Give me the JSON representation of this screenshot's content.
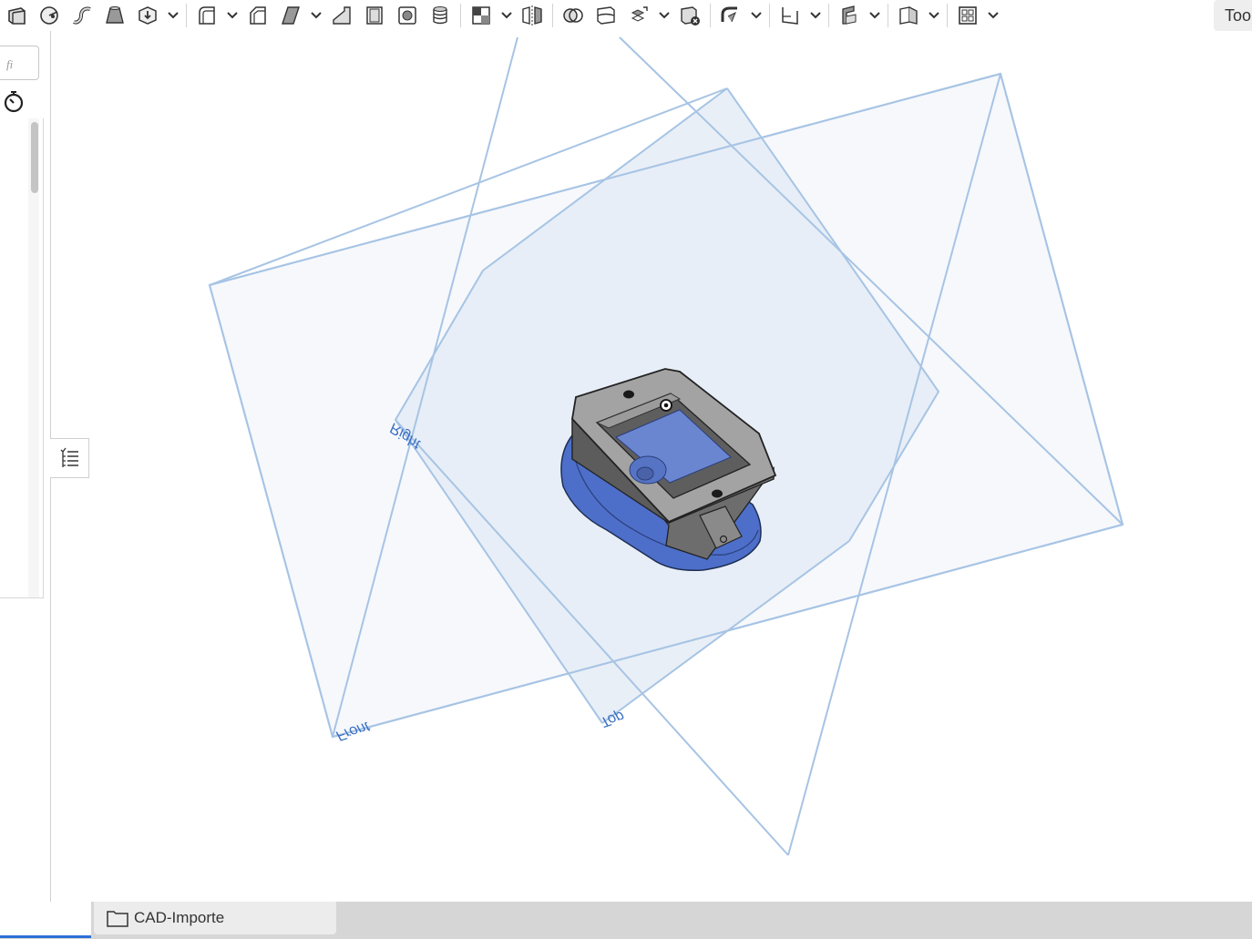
{
  "toolbar": {
    "icons": [
      "extrude-icon",
      "revolve-icon",
      "sweep-icon",
      "loft-icon",
      "thicken-icon",
      "fillet-icon",
      "chamfer-icon",
      "draft-icon",
      "rib-icon",
      "shell-icon",
      "hole-icon",
      "thread-icon",
      "pattern-icon",
      "mirror-icon",
      "boolean-icon",
      "split-icon",
      "transform-icon",
      "delete-part-icon",
      "modify-fillet-icon",
      "plane-icon",
      "sheet-metal-icon",
      "frame-icon",
      "layout-icon"
    ],
    "tools_label": "Tools"
  },
  "left_panel": {
    "filter_placeholder": "fi"
  },
  "viewport": {
    "planes": {
      "front_label": "Front",
      "top_label": "Top",
      "right_label": "Right"
    },
    "colors": {
      "plane_fill": "#e9eff8",
      "plane_stroke": "#9dbde0",
      "plane_label": "#3a6fc4",
      "part_base": "#4d6fc9",
      "part_body": "#707070",
      "part_top": "#9a9a9a"
    }
  },
  "bottom_bar": {
    "tab_label": "CAD-Importe"
  }
}
